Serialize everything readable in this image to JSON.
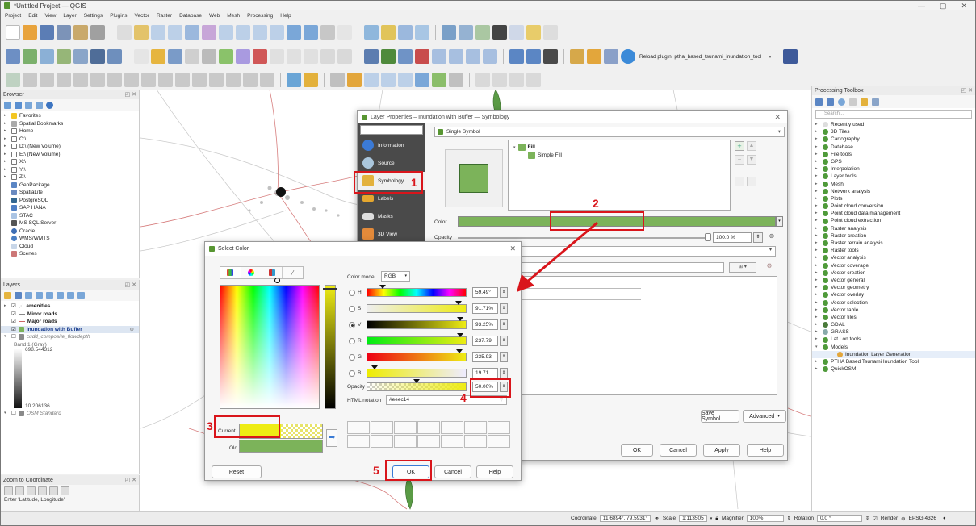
{
  "window": {
    "title": "*Untitled Project — QGIS"
  },
  "menu": [
    "Project",
    "Edit",
    "View",
    "Layer",
    "Settings",
    "Plugins",
    "Vector",
    "Raster",
    "Database",
    "Web",
    "Mesh",
    "Processing",
    "Help"
  ],
  "toolbar": {
    "reload_plugin_label": "Reload plugin: ptha_based_tsunami_inundation_tool"
  },
  "browser": {
    "title": "Browser",
    "items": [
      "Favorites",
      "Spatial Bookmarks",
      "Home",
      "C:\\",
      "D:\\ (New Volume)",
      "E:\\ (New Volume)",
      "X:\\",
      "Y:\\",
      "Z:\\",
      "GeoPackage",
      "SpatiaLite",
      "PostgreSQL",
      "SAP HANA",
      "STAC",
      "MS SQL Server",
      "Oracle",
      "WMS/WMTS",
      "Cloud",
      "Scenes"
    ]
  },
  "layers": {
    "title": "Layers",
    "items": [
      "amenities",
      "Minor roads",
      "Major roads",
      "Inundation with Buffer",
      "cudd_composite_flowdepth",
      "Band 1 (Gray)",
      "698.544312",
      "10.206136",
      "OSM Standard"
    ]
  },
  "zoom": {
    "title": "Zoom to Coordinate",
    "placeholder": "Enter 'Latitude, Longitude'"
  },
  "processing": {
    "title": "Processing Toolbox",
    "search_placeholder": "Search...",
    "items": [
      "Recently used",
      "3D Tiles",
      "Cartography",
      "Database",
      "File tools",
      "GPS",
      "Interpolation",
      "Layer tools",
      "Mesh",
      "Network analysis",
      "Plots",
      "Point cloud conversion",
      "Point cloud data management",
      "Point cloud extraction",
      "Raster analysis",
      "Raster creation",
      "Raster terrain analysis",
      "Raster tools",
      "Vector analysis",
      "Vector coverage",
      "Vector creation",
      "Vector general",
      "Vector geometry",
      "Vector overlay",
      "Vector selection",
      "Vector table",
      "Vector tiles",
      "GDAL",
      "GRASS",
      "Lat Lon tools",
      "Models",
      "Inundation Layer Generation",
      "PTHA Based Tsunami Inundation Tool",
      "QuickOSM"
    ]
  },
  "layer_props": {
    "title": "Layer Properties – Inundation with Buffer — Symbology",
    "renderer": "Single Symbol",
    "nav": [
      "Information",
      "Source",
      "Symbology",
      "Labels",
      "Masks",
      "3D View"
    ],
    "tree_fill": "Fill",
    "tree_simple_fill": "Simple Fill",
    "color_label": "Color",
    "opacity_label": "Opacity",
    "opacity_value": "100.0 %",
    "save_symbol": "Save Symbol...",
    "advanced": "Advanced",
    "ok": "OK",
    "cancel": "Cancel",
    "apply": "Apply",
    "help": "Help"
  },
  "select_color": {
    "title": "Select Color",
    "color_model_label": "Color model",
    "color_model": "RGB",
    "channels": [
      {
        "key": "H",
        "value": "59.49°",
        "level": 0.165
      },
      {
        "key": "S",
        "value": "91.71%",
        "level": 0.917
      },
      {
        "key": "V",
        "value": "93.25%",
        "level": 0.932
      },
      {
        "key": "R",
        "value": "237.79",
        "level": 0.933
      },
      {
        "key": "G",
        "value": "235.93",
        "level": 0.925
      },
      {
        "key": "B",
        "value": "19.71",
        "level": 0.077
      }
    ],
    "opacity_label": "Opacity",
    "opacity_value": "50.00%",
    "opacity_level": 0.5,
    "html_label": "HTML notation",
    "html_value": "#eeec14",
    "current_label": "Current",
    "old_label": "Old",
    "reset": "Reset",
    "ok": "OK",
    "cancel": "Cancel",
    "help": "Help"
  },
  "annotations": [
    "1",
    "2",
    "3",
    "4",
    "5"
  ],
  "statusbar": {
    "coordinate_label": "Coordinate",
    "coordinate_value": "11.6894°, 79.5931°",
    "scale_label": "Scale",
    "scale_value": "1:113505",
    "magnifier_label": "Magnifier",
    "magnifier_value": "100%",
    "rotation_label": "Rotation",
    "rotation_value": "0.0 °",
    "render_label": "Render",
    "crs": "EPSG:4326"
  },
  "colors": {
    "current_color": "#eeec14",
    "old_color": "#7cb35a",
    "fill_green": "#7cb35a",
    "annotation_red": "#d9151b",
    "nav_bg": "#4a4a4a"
  }
}
